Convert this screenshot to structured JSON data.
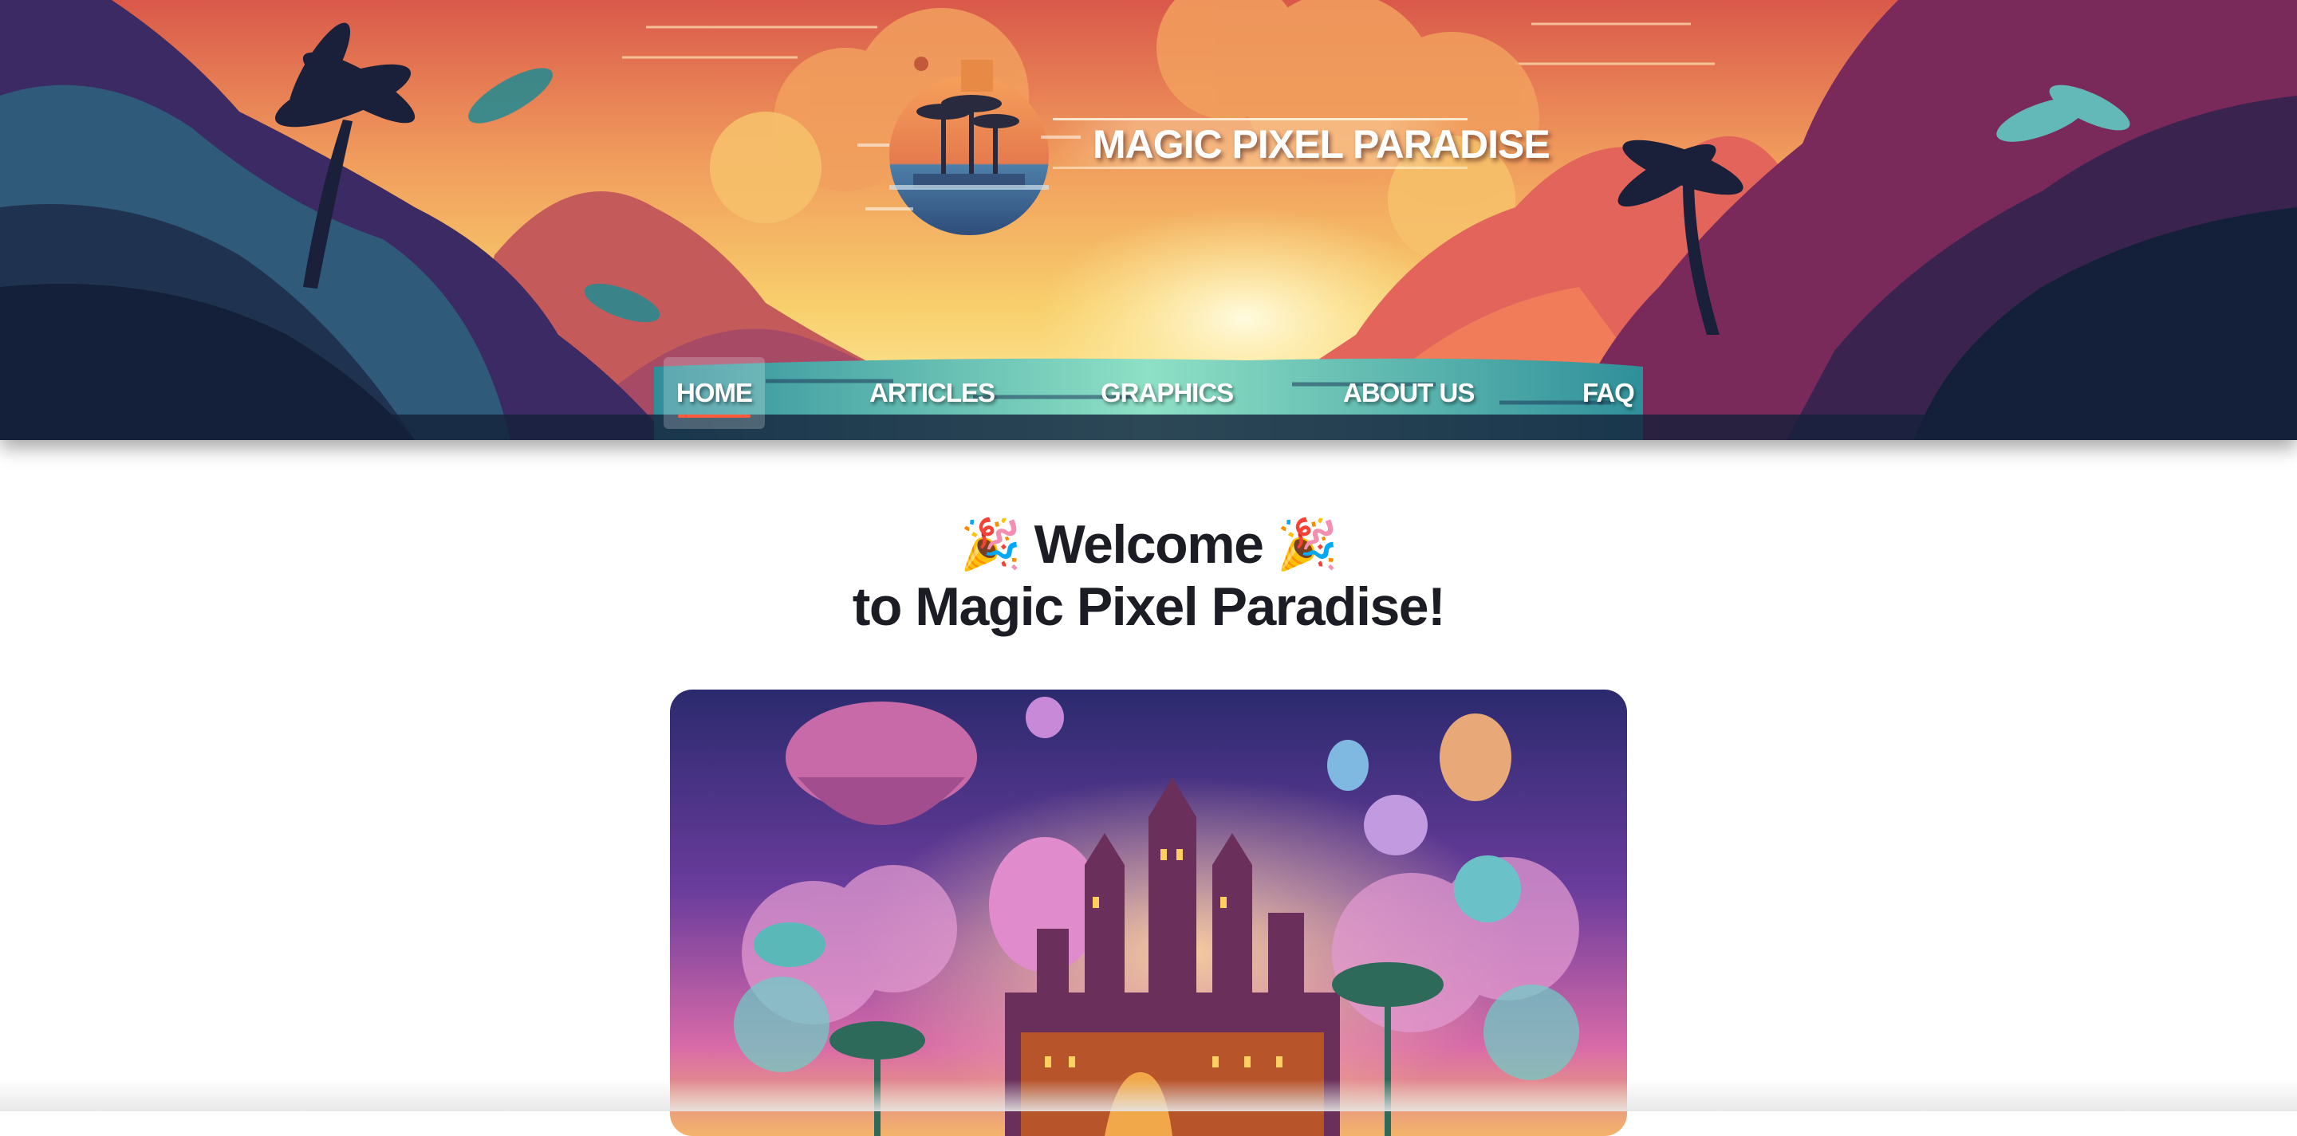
{
  "site": {
    "title": "MAGIC PIXEL PARADISE"
  },
  "nav": {
    "items": [
      {
        "label": "HOME",
        "active": true
      },
      {
        "label": "ARTICLES",
        "active": false
      },
      {
        "label": "GRAPHICS",
        "active": false
      },
      {
        "label": "ABOUT US",
        "active": false
      },
      {
        "label": "FAQ",
        "active": false
      }
    ]
  },
  "main": {
    "welcome_emoji": "🎉",
    "welcome_line1": "Welcome",
    "welcome_line2": "to Magic Pixel Paradise!"
  },
  "colors": {
    "sky_top": "#e86a4a",
    "sky_mid": "#f3b35a",
    "sky_glow": "#fff1a6",
    "jungle_dark": "#14203a",
    "water": "#5ccdb8",
    "accent": "#ff5a3c",
    "heading": "#1c1c24"
  },
  "icons": {
    "logo": "tropical-island-globe-logo",
    "hero": "fantasy-castle-balloons-illustration"
  }
}
